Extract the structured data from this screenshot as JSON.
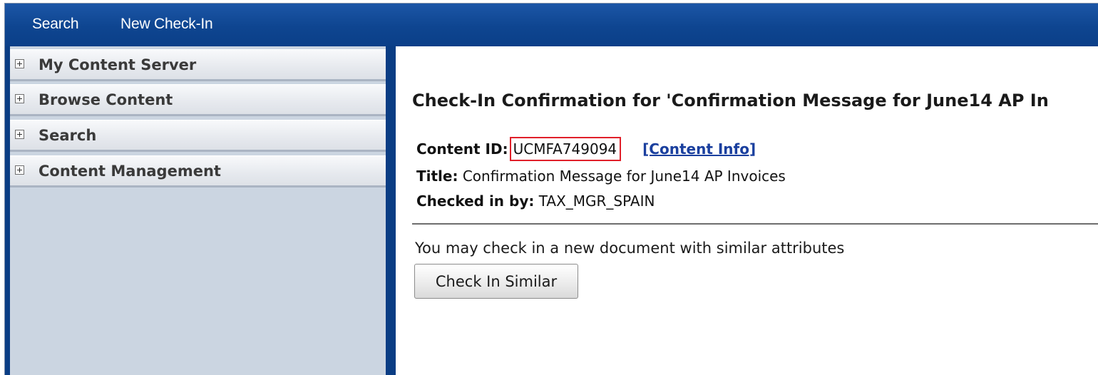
{
  "topnav": {
    "search": "Search",
    "new_checkin": "New Check-In"
  },
  "sidebar": {
    "items": [
      {
        "label": "My Content Server"
      },
      {
        "label": "Browse Content"
      },
      {
        "label": "Search"
      },
      {
        "label": "Content Management"
      }
    ]
  },
  "main": {
    "heading": "Check-In Confirmation for 'Confirmation Message for June14 AP In",
    "content_id_label": "Content ID:",
    "content_id_value": "UCMFA749094",
    "content_info_link": "[Content Info]",
    "title_label": "Title:",
    "title_value": "Confirmation Message for June14 AP Invoices",
    "checked_in_by_label": "Checked in by:",
    "checked_in_by_value": "TAX_MGR_SPAIN",
    "similar_text": "You may check in a new document with similar attributes",
    "check_in_similar_button": "Check In Similar"
  },
  "colors": {
    "topbar": "#0e4590",
    "frame": "#0a3d84",
    "highlight_box": "#e0202a",
    "link": "#1a3f9e"
  },
  "icons": {
    "sidebar_expand": "plus-box-icon"
  }
}
